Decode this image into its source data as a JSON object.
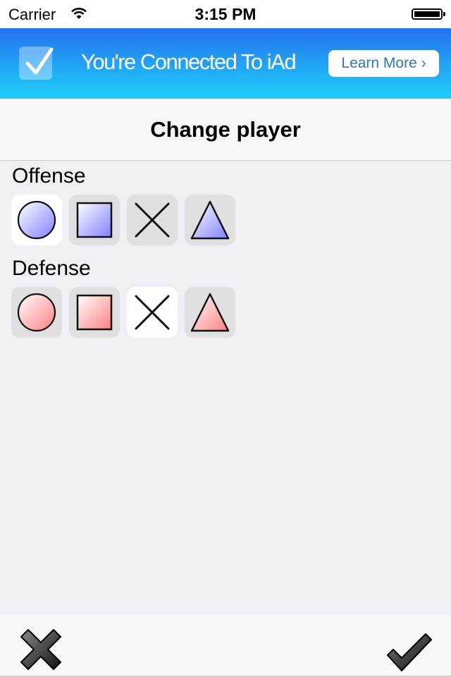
{
  "status_bar": {
    "carrier": "Carrier",
    "time": "3:15 PM",
    "battery_level": 1.0
  },
  "ad_banner": {
    "text": "You're Connected To iAd",
    "button_label": "Learn More ›"
  },
  "nav": {
    "title": "Change player"
  },
  "sections": [
    {
      "label": "Offense",
      "color": "#8080ff",
      "selected_index": 0,
      "shapes": [
        "circle",
        "square",
        "x",
        "triangle"
      ]
    },
    {
      "label": "Defense",
      "color": "#ff8080",
      "selected_index": 2,
      "shapes": [
        "circle",
        "square",
        "x",
        "triangle"
      ]
    }
  ],
  "toolbar": {
    "cancel_icon": "x-icon",
    "confirm_icon": "checkmark-icon"
  }
}
